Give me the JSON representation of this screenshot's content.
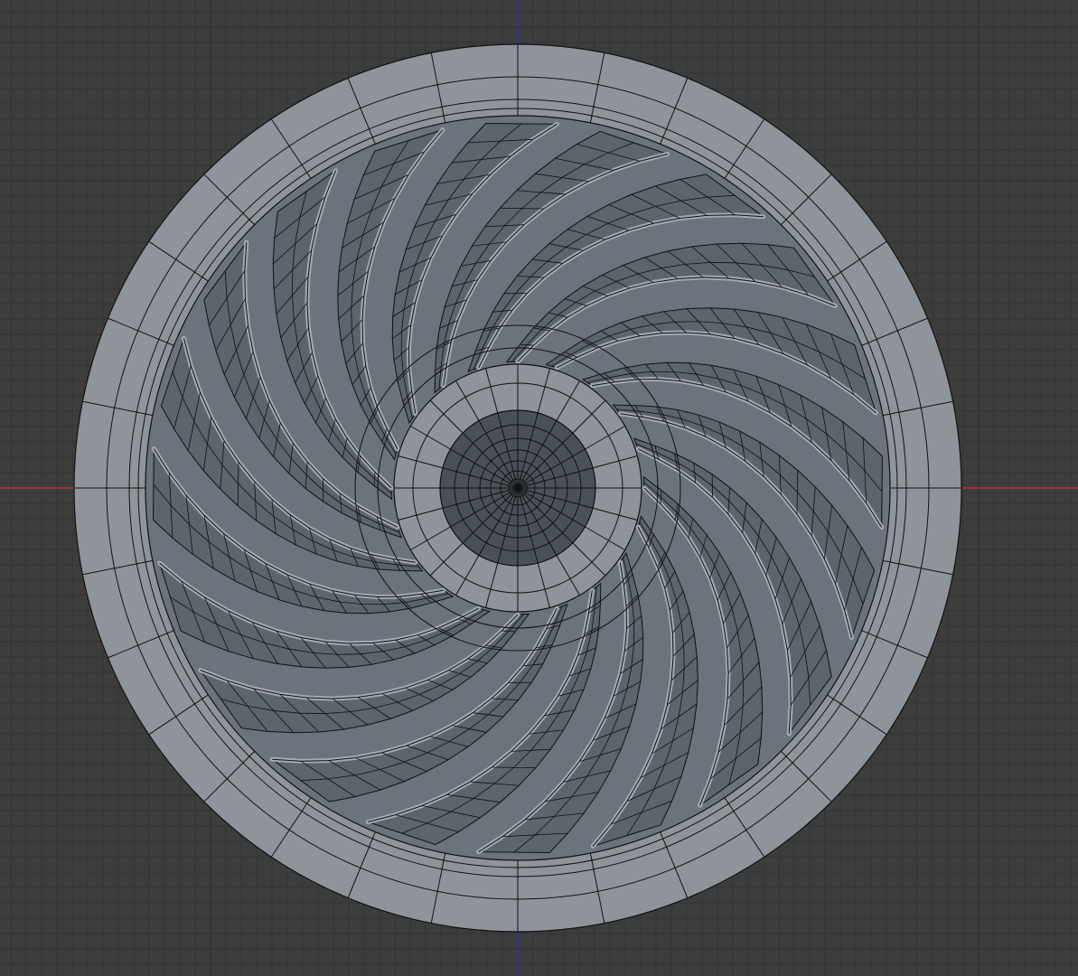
{
  "viewport": {
    "name": "3D Viewport",
    "view": "top-orthographic",
    "colors": {
      "background": "#3d3d3d",
      "grid_minor": "#343434",
      "grid_major": "#2e2e2e",
      "axis_x": "#c83232",
      "axis_y": "#2828e0",
      "rim_face": "#8f949b",
      "rim_face_light": "#9aa0a7",
      "bowl_face": "#6b737c",
      "blade_face": "#5c646d",
      "blade_edge_light": "#a4aab1",
      "hub_face": "#8f949b",
      "center_face": "#4a5058",
      "wire": "#111111"
    }
  },
  "mesh": {
    "object": "turbine-fan",
    "outer_rim_segments": 32,
    "blade_count": 20,
    "hub_segments": 24
  }
}
